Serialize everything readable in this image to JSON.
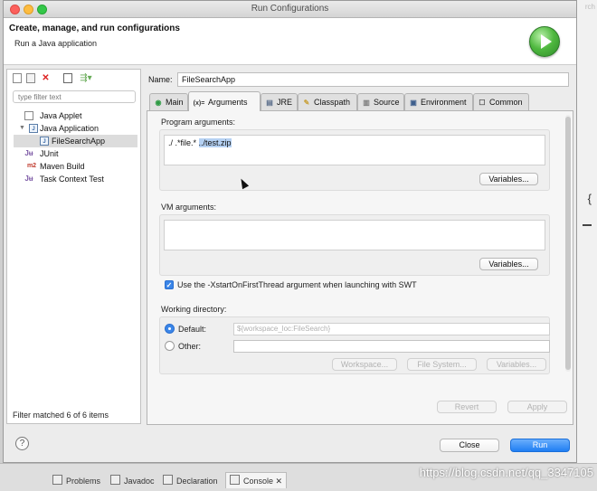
{
  "window": {
    "title": "Run Configurations"
  },
  "background": {
    "search_fragment": "rch",
    "brace": "{"
  },
  "banner": {
    "title": "Create, manage, and run configurations",
    "subtitle": "Run a Java application"
  },
  "left": {
    "filter_placeholder": "type filter text",
    "tree": [
      {
        "label": "Java Applet",
        "icon": "java-applet-icon"
      },
      {
        "label": "Java Application",
        "icon": "java-application-icon",
        "expanded": true
      },
      {
        "label": "FileSearchApp",
        "icon": "java-application-icon",
        "selected": true
      },
      {
        "label": "JUnit",
        "icon": "junit-icon"
      },
      {
        "label": "Maven Build",
        "icon": "maven-icon",
        "badge": "m2"
      },
      {
        "label": "Task Context Test",
        "icon": "junit-icon"
      }
    ],
    "status": "Filter matched 6 of 6 items"
  },
  "config": {
    "name_label": "Name:",
    "name_value": "FileSearchApp",
    "tabs": [
      {
        "label": "Main",
        "icon": "main-tab-icon"
      },
      {
        "label": "Arguments",
        "icon": "arguments-tab-icon",
        "active": true
      },
      {
        "label": "JRE",
        "icon": "jre-tab-icon"
      },
      {
        "label": "Classpath",
        "icon": "classpath-tab-icon"
      },
      {
        "label": "Source",
        "icon": "source-tab-icon"
      },
      {
        "label": "Environment",
        "icon": "environment-tab-icon"
      },
      {
        "label": "Common",
        "icon": "common-tab-icon"
      }
    ]
  },
  "arguments": {
    "program_label": "Program arguments:",
    "program_value_plain": "./ .*file.* ",
    "program_value_selected": "../test.zip",
    "variables_label": "Variables...",
    "vm_label": "VM arguments:",
    "vm_value": "",
    "xstart_checked": true,
    "xstart_label": "Use the -XstartOnFirstThread argument when launching with SWT",
    "working_dir_label": "Working directory:",
    "default_label": "Default:",
    "default_value": "${workspace_loc:FileSearch}",
    "other_label": "Other:",
    "workspace_btn": "Workspace...",
    "filesystem_btn": "File System...",
    "wd_variables_btn": "Variables..."
  },
  "actions": {
    "revert": "Revert",
    "apply": "Apply",
    "close": "Close",
    "run": "Run"
  },
  "bottom_tabs": [
    {
      "label": "Problems"
    },
    {
      "label": "Javadoc"
    },
    {
      "label": "Declaration"
    },
    {
      "label": "Console",
      "active": true
    }
  ],
  "watermark": "https://blog.csdn.net/qq_3347105"
}
